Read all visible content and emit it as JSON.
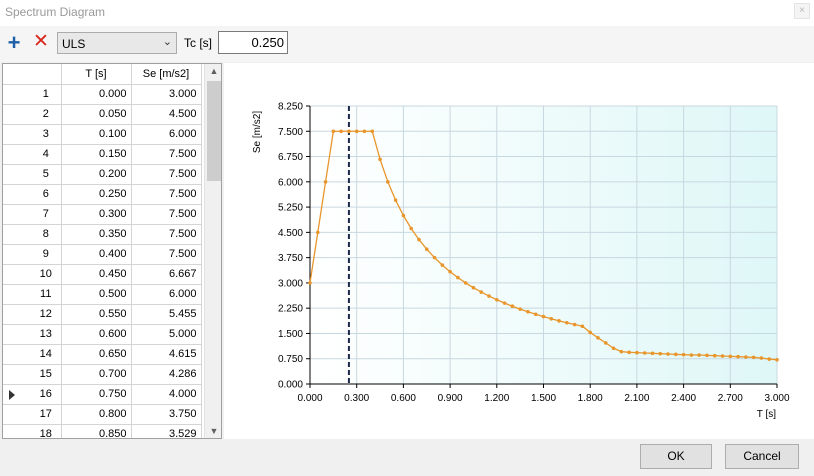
{
  "window": {
    "title": "Spectrum Diagram",
    "close_glyph": "×"
  },
  "toolbar": {
    "add_icon": "plus-icon",
    "delete_icon": "red-x-icon",
    "spectrum_type": "ULS",
    "tc_label": "Tc  [s]",
    "tc_value": "0.250"
  },
  "table": {
    "columns": [
      "T [s]",
      "Se [m/s2]"
    ],
    "current_row": 16,
    "rows": [
      {
        "n": "1",
        "t": "0.000",
        "se": "3.000"
      },
      {
        "n": "2",
        "t": "0.050",
        "se": "4.500"
      },
      {
        "n": "3",
        "t": "0.100",
        "se": "6.000"
      },
      {
        "n": "4",
        "t": "0.150",
        "se": "7.500"
      },
      {
        "n": "5",
        "t": "0.200",
        "se": "7.500"
      },
      {
        "n": "6",
        "t": "0.250",
        "se": "7.500"
      },
      {
        "n": "7",
        "t": "0.300",
        "se": "7.500"
      },
      {
        "n": "8",
        "t": "0.350",
        "se": "7.500"
      },
      {
        "n": "9",
        "t": "0.400",
        "se": "7.500"
      },
      {
        "n": "10",
        "t": "0.450",
        "se": "6.667"
      },
      {
        "n": "11",
        "t": "0.500",
        "se": "6.000"
      },
      {
        "n": "12",
        "t": "0.550",
        "se": "5.455"
      },
      {
        "n": "13",
        "t": "0.600",
        "se": "5.000"
      },
      {
        "n": "14",
        "t": "0.650",
        "se": "4.615"
      },
      {
        "n": "15",
        "t": "0.700",
        "se": "4.286"
      },
      {
        "n": "16",
        "t": "0.750",
        "se": "4.000"
      },
      {
        "n": "17",
        "t": "0.800",
        "se": "3.750"
      },
      {
        "n": "18",
        "t": "0.850",
        "se": "3.529"
      }
    ]
  },
  "chart_data": {
    "type": "line",
    "title": "",
    "xlabel": "T [s]",
    "ylabel": "Se [m/s2]",
    "xlim": [
      0,
      3.0
    ],
    "ylim": [
      0,
      8.25
    ],
    "x_ticks": [
      "0.000",
      "0.300",
      "0.600",
      "0.900",
      "1.200",
      "1.500",
      "1.800",
      "2.100",
      "2.400",
      "2.700",
      "3.000"
    ],
    "y_ticks": [
      "0.000",
      "0.750",
      "1.500",
      "2.250",
      "3.000",
      "3.750",
      "4.500",
      "5.250",
      "6.000",
      "6.750",
      "7.500",
      "8.250"
    ],
    "grid": true,
    "vline_x": 0.25,
    "colors": {
      "line": "#e8962b",
      "vline": "#1a2a4a",
      "plot_bg_left": "#ffffff",
      "plot_bg_right": "#dff7f7",
      "grid": "#c8d8e0"
    },
    "series": [
      {
        "x": [
          0,
          0.05,
          0.1,
          0.15,
          0.2,
          0.25,
          0.3,
          0.35,
          0.4,
          0.45,
          0.5,
          0.55,
          0.6,
          0.65,
          0.7,
          0.75,
          0.8,
          0.85,
          0.9,
          0.95,
          1.0,
          1.05,
          1.1,
          1.15,
          1.2,
          1.25,
          1.3,
          1.35,
          1.4,
          1.45,
          1.5,
          1.55,
          1.6,
          1.65,
          1.7,
          1.75,
          1.8,
          1.85,
          1.9,
          1.95,
          2.0,
          2.05,
          2.1,
          2.15,
          2.2,
          2.25,
          2.3,
          2.35,
          2.4,
          2.45,
          2.5,
          2.55,
          2.6,
          2.65,
          2.7,
          2.75,
          2.8,
          2.85,
          2.9,
          2.95,
          3.0
        ],
        "y": [
          3.0,
          4.5,
          6.0,
          7.5,
          7.5,
          7.5,
          7.5,
          7.5,
          7.5,
          6.667,
          6.0,
          5.455,
          5.0,
          4.615,
          4.286,
          4.0,
          3.75,
          3.529,
          3.333,
          3.158,
          3.0,
          2.857,
          2.727,
          2.609,
          2.5,
          2.4,
          2.308,
          2.222,
          2.143,
          2.069,
          2.0,
          1.935,
          1.875,
          1.818,
          1.765,
          1.714,
          1.53,
          1.37,
          1.22,
          1.06,
          0.96,
          0.94,
          0.93,
          0.92,
          0.91,
          0.9,
          0.89,
          0.88,
          0.87,
          0.86,
          0.86,
          0.85,
          0.84,
          0.83,
          0.82,
          0.81,
          0.8,
          0.79,
          0.77,
          0.74,
          0.72
        ]
      }
    ]
  },
  "footer": {
    "ok_label": "OK",
    "cancel_label": "Cancel"
  }
}
